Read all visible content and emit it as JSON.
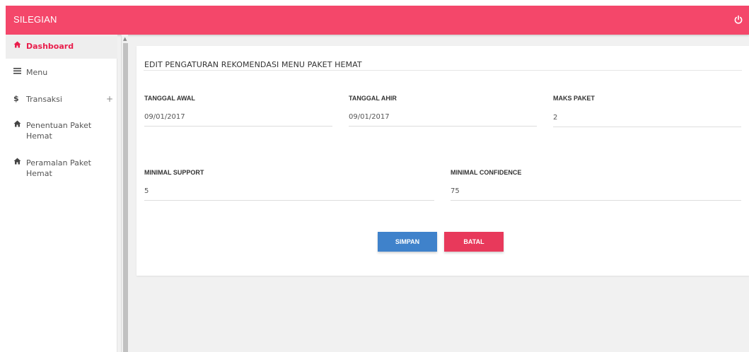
{
  "app": {
    "title": "SILEGIAN"
  },
  "sidebar": {
    "items": [
      {
        "label": "Dashboard",
        "icon": "home-icon",
        "active": true
      },
      {
        "label": "Menu",
        "icon": "bars-icon"
      },
      {
        "label": "Transaksi",
        "icon": "dollar-icon",
        "expand": "+"
      },
      {
        "label": "Penentuan Paket\nHemat",
        "icon": "home-icon"
      },
      {
        "label": "Peramalan Paket\nHemat",
        "icon": "home-icon"
      }
    ]
  },
  "form": {
    "title": "EDIT PENGATURAN REKOMENDASI MENU PAKET HEMAT",
    "fields": {
      "tanggal_awal": {
        "label": "TANGGAL AWAL",
        "value": "09/01/2017"
      },
      "tanggal_ahir": {
        "label": "TANGGAL AHIR",
        "value": "09/01/2017"
      },
      "maks_paket": {
        "label": "MAKS PAKET",
        "value": "2"
      },
      "minimal_support": {
        "label": "MINIMAL SUPPORT",
        "value": "5"
      },
      "minimal_confidence": {
        "label": "MINIMAL CONFIDENCE",
        "value": "75"
      }
    },
    "buttons": {
      "save": "SIMPAN",
      "cancel": "BATAL"
    }
  },
  "colors": {
    "topbar": "#f4476a",
    "active_nav": "#e91e4c",
    "save_button": "#3f82cb",
    "cancel_button": "#e8395b"
  }
}
